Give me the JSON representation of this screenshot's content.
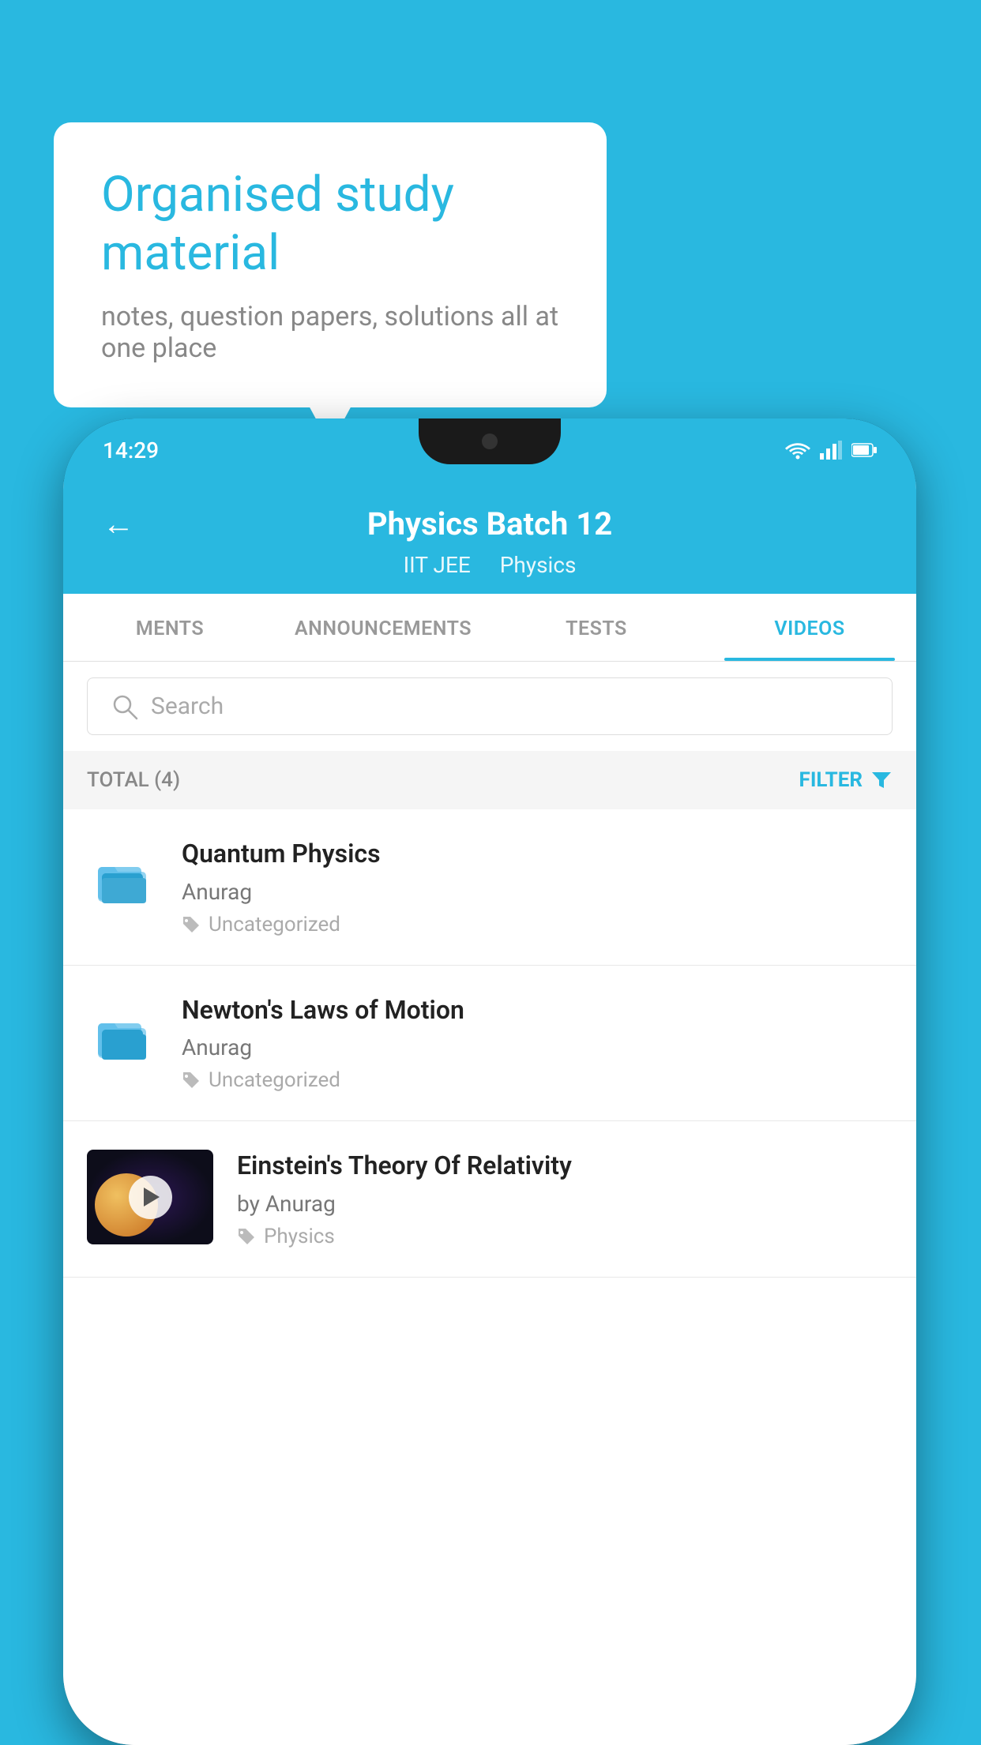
{
  "background_color": "#29b8e0",
  "bubble": {
    "title": "Organised study material",
    "subtitle": "notes, question papers, solutions all at one place"
  },
  "phone": {
    "status_time": "14:29",
    "header": {
      "title": "Physics Batch 12",
      "subtitle1": "IIT JEE",
      "subtitle2": "Physics",
      "back_label": "←"
    },
    "tabs": [
      {
        "label": "MENTS",
        "active": false
      },
      {
        "label": "ANNOUNCEMENTS",
        "active": false
      },
      {
        "label": "TESTS",
        "active": false
      },
      {
        "label": "VIDEOS",
        "active": true
      }
    ],
    "search": {
      "placeholder": "Search"
    },
    "filter": {
      "total_label": "TOTAL (4)",
      "filter_label": "FILTER"
    },
    "videos": [
      {
        "id": 1,
        "title": "Quantum Physics",
        "author": "Anurag",
        "tag": "Uncategorized",
        "has_thumbnail": false
      },
      {
        "id": 2,
        "title": "Newton's Laws of Motion",
        "author": "Anurag",
        "tag": "Uncategorized",
        "has_thumbnail": false
      },
      {
        "id": 3,
        "title": "Einstein's Theory Of Relativity",
        "author": "by Anurag",
        "tag": "Physics",
        "has_thumbnail": true
      }
    ]
  }
}
